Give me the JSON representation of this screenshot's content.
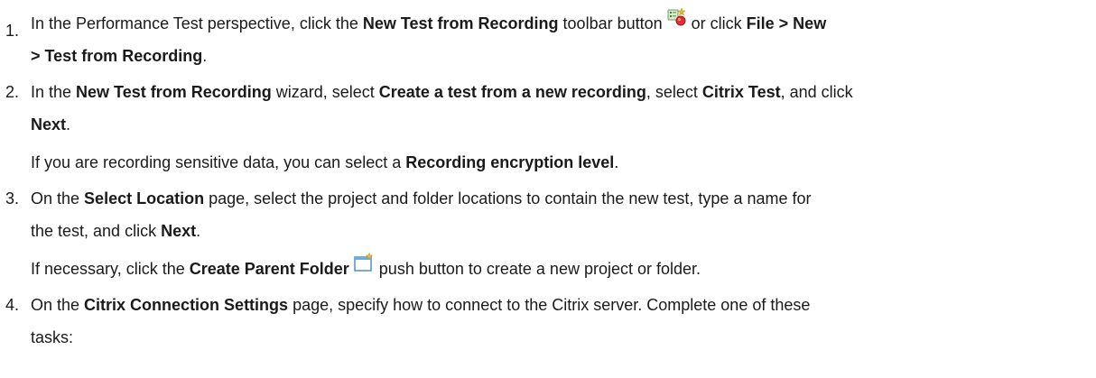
{
  "steps": [
    {
      "number": "1.",
      "t1": "In the Performance Test perspective, click the ",
      "b1": "New Test from Recording",
      "t2": " toolbar button ",
      "icon": "new-test-from-recording-icon",
      "t3": " or click ",
      "b2": "File > New",
      "b3": "> Test from Recording",
      "t4": "."
    },
    {
      "number": "2.",
      "t1": "In the ",
      "b1": "New Test from Recording",
      "t2": " wizard, select ",
      "b2": "Create a test from a new recording",
      "t3": ", select ",
      "b3": "Citrix Test",
      "t4": ", and click",
      "b4": "Next",
      "t5": ".",
      "note_t1": "If you are recording sensitive data, you can select a ",
      "note_b1": "Recording encryption level",
      "note_t2": "."
    },
    {
      "number": "3.",
      "t1": "On the ",
      "b1": "Select Location",
      "t2": " page, select the project and folder locations to contain the new test, type a name for",
      "t3": "the test, and click ",
      "b2": "Next",
      "t4": ".",
      "note_t1": "If necessary, click the ",
      "note_b1": "Create Parent Folder",
      "note_icon": "create-parent-folder-icon",
      "note_t2": " push button to create a new project or folder."
    },
    {
      "number": "4.",
      "t1": "On the ",
      "b1": "Citrix Connection Settings",
      "t2": " page, specify how to connect to the Citrix server. Complete one of these",
      "t3": "tasks:"
    }
  ]
}
